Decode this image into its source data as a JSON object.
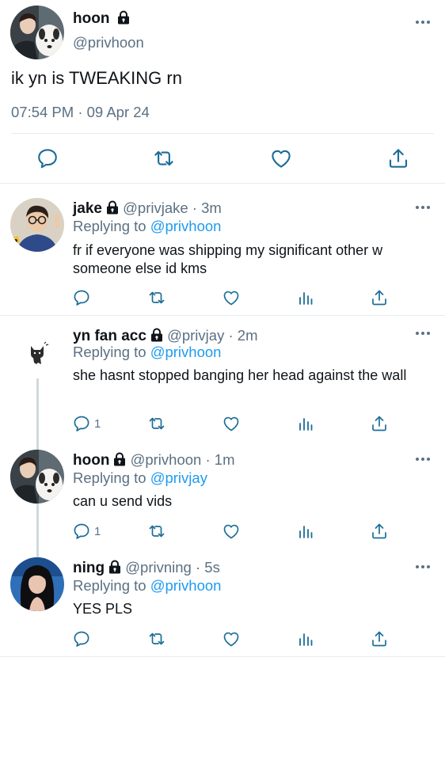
{
  "main_tweet": {
    "name": "hoon",
    "handle": "@privhoon",
    "text": "ik yn is TWEAKING rn",
    "timestamp": "07:54 PM · 09 Apr 24",
    "icons": [
      "reply-icon",
      "retweet-icon",
      "like-icon",
      "share-icon"
    ]
  },
  "replies": [
    {
      "name": "jake",
      "handle": "@privjake",
      "time": "3m",
      "replying_prefix": "Replying to",
      "replying_to": "@privhoon",
      "text": "fr if everyone was shipping my significant other w someone else id kms",
      "reply_count": ""
    },
    {
      "name": "yn fan acc",
      "handle": "@privjay",
      "time": "2m",
      "replying_prefix": "Replying to",
      "replying_to": "@privhoon",
      "text": "she hasnt stopped banging her head against the wall",
      "reply_count": "1"
    },
    {
      "name": "hoon",
      "handle": "@privhoon",
      "time": "1m",
      "replying_prefix": "Replying to",
      "replying_to": "@privjay",
      "text": "can u send vids",
      "reply_count": "1"
    },
    {
      "name": "ning",
      "handle": "@privning",
      "time": "5s",
      "replying_prefix": "Replying to",
      "replying_to": "@privhoon",
      "text": "YES PLS",
      "reply_count": ""
    }
  ],
  "separator": "·",
  "colors": {
    "link": "#1d9bf0",
    "muted": "#5b7083",
    "text": "#0f1419",
    "border": "#e6ecf0"
  }
}
